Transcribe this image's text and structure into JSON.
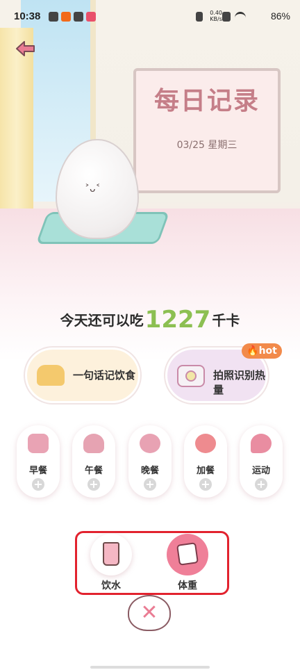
{
  "status_bar": {
    "time": "10:38",
    "net_speed_value": "0.40",
    "net_speed_unit": "KB/s",
    "battery": "86%"
  },
  "header": {
    "board_title": "每日记录",
    "date": "03/25 星期三"
  },
  "calorie": {
    "prefix": "今天还可以吃",
    "value": "1227",
    "unit": "千卡"
  },
  "actions": {
    "text_log_label": "一句话记饮食",
    "photo_label": "拍照识别热量",
    "hot_badge": "hot"
  },
  "meals": [
    {
      "label": "早餐",
      "icon": "bread-icon",
      "color": "#e9a3b4"
    },
    {
      "label": "午餐",
      "icon": "rice-bowl-icon",
      "color": "#e6a3b2"
    },
    {
      "label": "晚餐",
      "icon": "plate-icon",
      "color": "#e8a2b3"
    },
    {
      "label": "加餐",
      "icon": "tomato-icon",
      "color": "#ee8b8f"
    },
    {
      "label": "运动",
      "icon": "pingpong-icon",
      "color": "#e98da1"
    }
  ],
  "options": {
    "water_label": "饮水",
    "weight_label": "体重"
  },
  "colors": {
    "accent_green": "#8cbf52",
    "accent_pink": "#ef7f98",
    "highlight_red": "#e2222e"
  }
}
